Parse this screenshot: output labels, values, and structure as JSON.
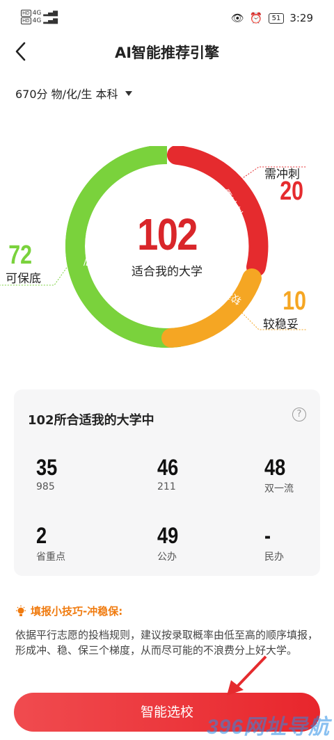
{
  "status_bar": {
    "network_left": [
      "4G",
      "4G"
    ],
    "time": "3:29",
    "battery": "51"
  },
  "header": {
    "title": "AI智能推荐引擎"
  },
  "score_selector": {
    "value": "670分 物/化/生 本科"
  },
  "donut": {
    "total": "102",
    "total_label": "适合我的大学",
    "segments": [
      {
        "name": "需冲刺",
        "count": "20",
        "arc_label": "需冲刺",
        "color": "#e52b2e"
      },
      {
        "name": "较稳妥",
        "count": "10",
        "arc_label": "较稳妥",
        "color": "#f5a623"
      },
      {
        "name": "可保底",
        "count": "72",
        "arc_label": "可保底",
        "color": "#7ad23c"
      }
    ]
  },
  "card": {
    "title": "102所合适我的大学中",
    "stats": [
      {
        "value": "35",
        "label": "985"
      },
      {
        "value": "46",
        "label": "211"
      },
      {
        "value": "48",
        "label": "双一流"
      },
      {
        "value": "2",
        "label": "省重点"
      },
      {
        "value": "49",
        "label": "公办"
      },
      {
        "value": "-",
        "label": "民办"
      }
    ]
  },
  "tip": {
    "title": "填报小技巧-冲稳保:",
    "body": "依据平行志愿的投档规则，建议按录取概率由低至高的顺序填报，形成冲、稳、保三个梯度，从而尽可能的不浪费分上好大学。"
  },
  "cta": {
    "label": "智能选校"
  },
  "watermark": "396网址导航",
  "icons": {
    "back": "chevron-left-icon",
    "help": "question-circle-icon",
    "tip": "lightbulb-icon",
    "dropdown": "triangle-down-icon"
  }
}
